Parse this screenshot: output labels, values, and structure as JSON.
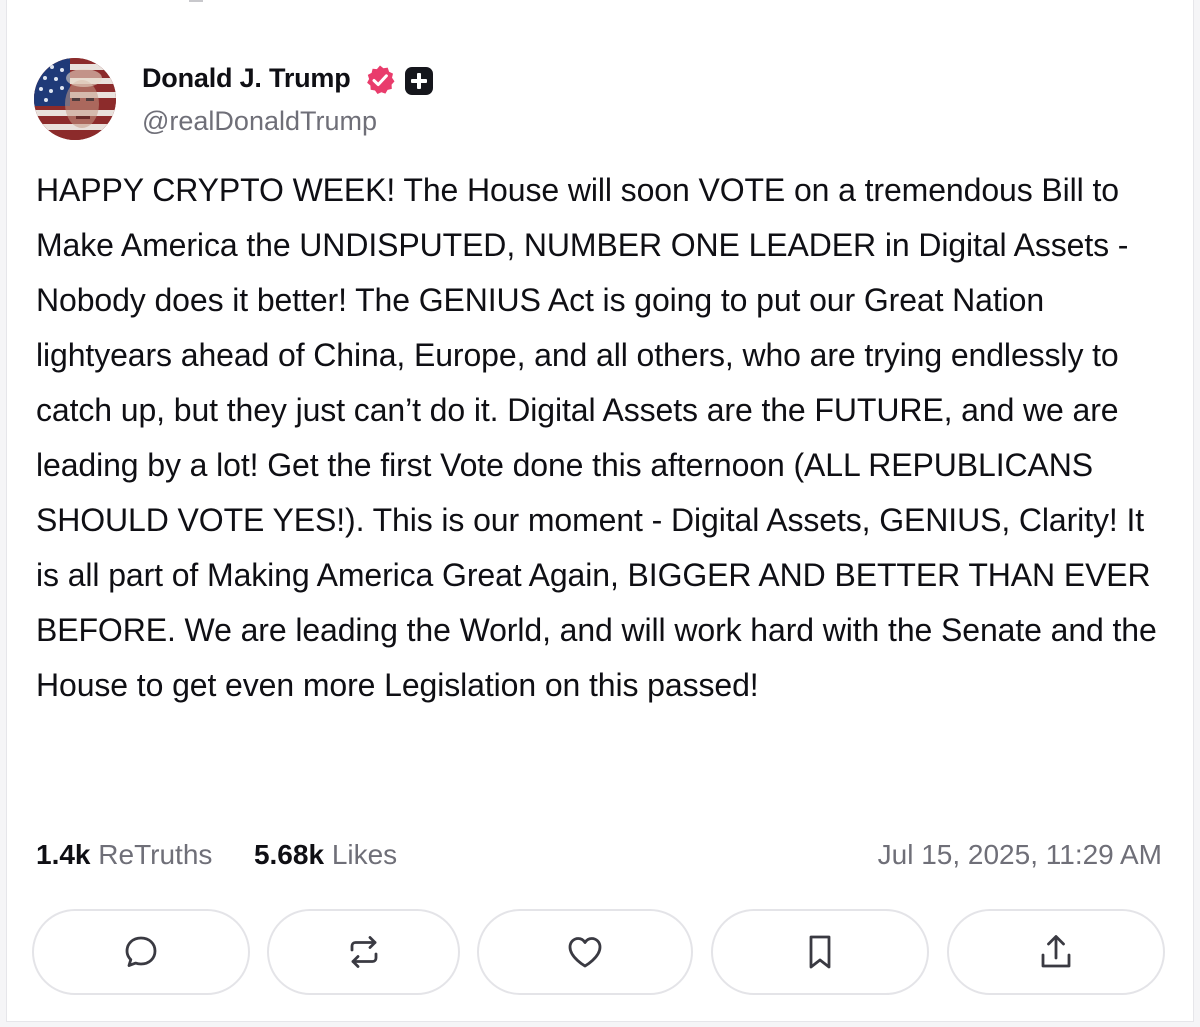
{
  "author": {
    "display_name": "Donald J. Trump",
    "handle": "@realDonaldTrump",
    "avatar_icon": "flag-portrait-avatar",
    "verified_icon": "verified-badge-icon",
    "verified_color": "#e93c6c",
    "extra_badge_icon": "plus-badge-icon"
  },
  "post": {
    "text": "HAPPY CRYPTO WEEK! The House will soon VOTE on a tremendous Bill to Make America the UNDISPUTED, NUMBER ONE LEADER in Digital Assets - Nobody does it better! The GENIUS Act is going to put our Great Nation lightyears ahead of China, Europe, and all others, who are trying endlessly to catch up, but they just can’t do it. Digital Assets are the FUTURE, and we are leading by a lot! Get the first Vote done this afternoon (ALL REPUBLICANS SHOULD VOTE YES!). This is our moment - Digital Assets, GENIUS, Clarity! It is all part of Making America Great Again, BIGGER AND BETTER THAN EVER BEFORE. We are leading the World, and will work hard with the Senate and the House to get even more Legislation on this passed!",
    "retruths_count": "1.4k",
    "retruths_label": "ReTruths",
    "likes_count": "5.68k",
    "likes_label": "Likes",
    "timestamp": "Jul 15, 2025, 11:29 AM"
  },
  "actions": [
    {
      "name": "reply",
      "icon": "comment-icon"
    },
    {
      "name": "retruth",
      "icon": "repost-icon"
    },
    {
      "name": "like",
      "icon": "heart-icon"
    },
    {
      "name": "bookmark",
      "icon": "bookmark-icon"
    },
    {
      "name": "share",
      "icon": "share-icon"
    }
  ],
  "colors": {
    "text_primary": "#0f0f14",
    "text_secondary": "#6f6f78",
    "border": "#e4e4e8"
  }
}
